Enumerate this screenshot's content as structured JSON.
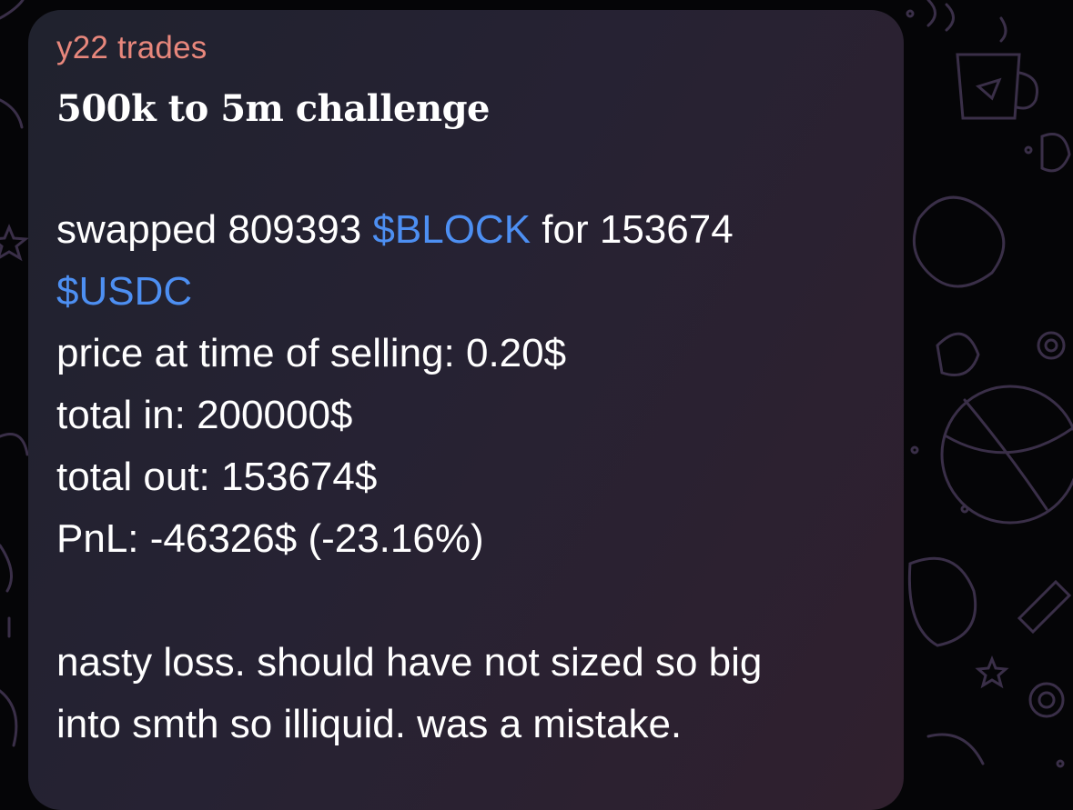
{
  "message": {
    "sender_name": "y22 trades",
    "title": "500k to 5m challenge",
    "swap_line": {
      "prefix": "swapped 809393 ",
      "token_in": "$BLOCK",
      "middle": " for 153674",
      "token_out": "$USDC"
    },
    "lines": {
      "price": "price at time of selling: 0.20$",
      "total_in": "total in: 200000$",
      "total_out": "total out: 153674$",
      "pnl": "PnL: -46326$ (-23.16%)"
    },
    "note": {
      "line1": "nasty loss. should have not sized so big",
      "line2": "into smth so illiquid. was a mistake."
    }
  },
  "colors": {
    "sender": "#e8877c",
    "link": "#4d8ff2",
    "bubble": "#262233",
    "background": "#050507"
  }
}
